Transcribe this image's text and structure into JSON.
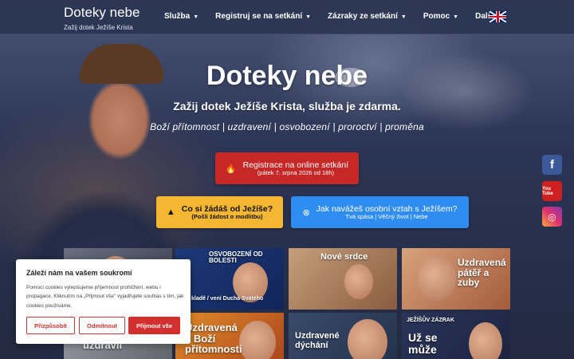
{
  "header": {
    "brand_title": "Doteky nebe",
    "brand_subtitle": "Zažij dotek Ježíše Krista",
    "nav": [
      {
        "label": "Služba"
      },
      {
        "label": "Registruj se na setkání"
      },
      {
        "label": "Zázraky ze setkání"
      },
      {
        "label": "Pomoc"
      },
      {
        "label": "Další"
      }
    ],
    "language_flag": "uk-flag-icon"
  },
  "hero": {
    "title": "Doteky nebe",
    "subtitle": "Zažij dotek Ježíše Krista, služba je zdarma.",
    "tagline": "Boží přítomnost | uzdravení | osvobození | proroctví | proměna"
  },
  "buttons": {
    "register": {
      "main": "Registrace na online setkání",
      "sub": "(pátek 7. srpna 2026 od 18h)",
      "icon": "flame-icon",
      "color": "#c62828"
    },
    "prayer": {
      "main": "Co si žádáš od Ježíše?",
      "sub": "(Pošli žádost o modlitbu)",
      "icon": "praying-hands-icon",
      "color": "#f5b731"
    },
    "relationship": {
      "main": "Jak navážeš osobní vztah s Ježíšem?",
      "sub": "Tvá spása | Věčný život | Nebe",
      "icon": "life-ring-icon",
      "color": "#2f8cf0"
    }
  },
  "social": [
    {
      "name": "facebook-icon",
      "glyph": "f"
    },
    {
      "name": "youtube-icon",
      "glyph": "You Tube"
    },
    {
      "name": "instagram-icon",
      "glyph": "◎"
    }
  ],
  "videos": [
    {
      "caption": ""
    },
    {
      "caption": "OSVOBOZENÍ OD BOLESTI",
      "sub": "kladě / vení Ducha Svatého"
    },
    {
      "caption": "Nové srdce"
    },
    {
      "caption": "Uzdravená pátěř a zuby"
    },
    {
      "caption": "Ježíš uzdravil"
    },
    {
      "caption": "Uzdravená v Boží přítomnosti"
    },
    {
      "caption": "Uzdravené dýchání"
    },
    {
      "caption": "JEŽÍŠŮV ZÁZRAK",
      "sub": "Už se může"
    }
  ],
  "cookie": {
    "title": "Záleží nám na vašem soukromí",
    "text": "Pomocí cookies vylepšujeme příjemnost prohlížení, webu i propagace. Kliknutím na „Přijmout vše\" vyjadřujete souhlas s tím, jak cookies používáme.",
    "customize": "Přizpůsobit",
    "reject": "Odmítnout",
    "accept": "Přijmout vše"
  }
}
